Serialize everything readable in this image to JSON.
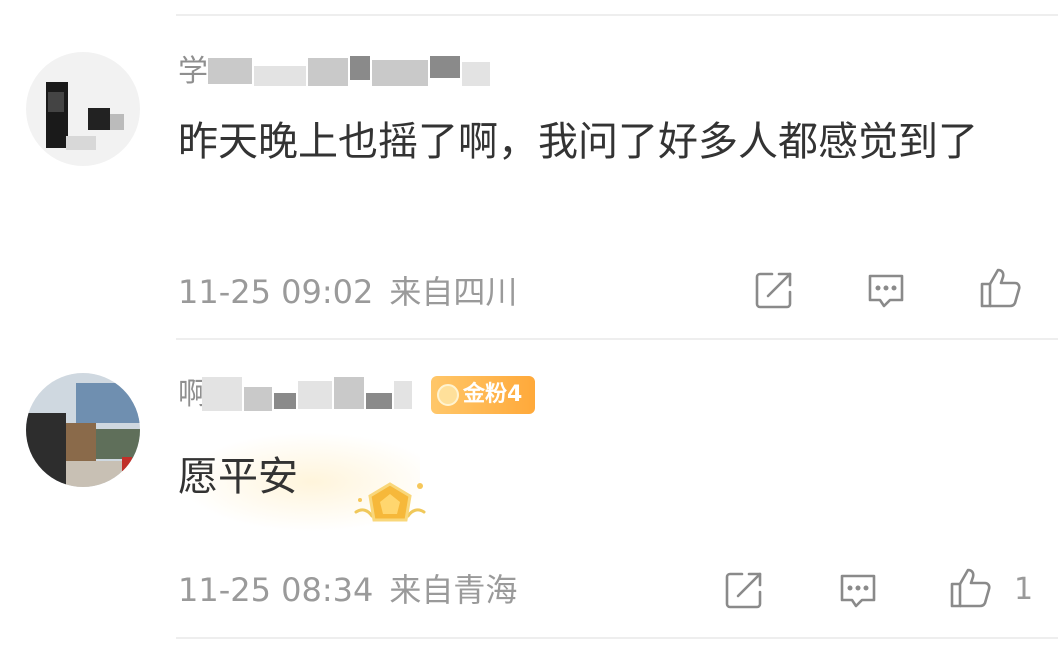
{
  "comments": [
    {
      "username": "学",
      "text": "昨天晚上也摇了啊，我问了好多人都感觉到了",
      "time": "11-25 09:02",
      "location": "来自四川",
      "likes": ""
    },
    {
      "username": "啊",
      "badge": "金粉4",
      "text": "愿平安",
      "time": "11-25 08:34",
      "location": "来自青海",
      "likes": "1"
    }
  ],
  "icons": {
    "share": "share-icon",
    "reply": "comment-icon",
    "like": "thumbs-up-icon"
  },
  "colors": {
    "text": "#333333",
    "meta": "#9a9a9a",
    "badge": "#ffb347"
  }
}
